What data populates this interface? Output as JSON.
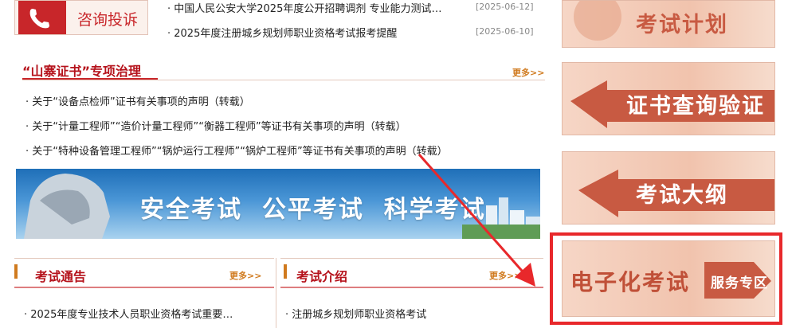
{
  "consult": {
    "label": "咨询投诉",
    "icon": "phone-icon"
  },
  "top_news": [
    {
      "title": "中国人民公安大学2025年度公开招聘调剂 专业能力测试…",
      "date": "[2025-06-12]"
    },
    {
      "title": "2025年度注册城乡规划师职业资格考试报考提醒",
      "date": "[2025-06-10]"
    }
  ],
  "fake_cert": {
    "title": "“山寨证书”专项治理",
    "more": "更多>>",
    "items": [
      "关于“设备点检师”证书有关事项的声明（转载）",
      "关于“计量工程师”“造价计量工程师”“衡器工程师”等证书有关事项的声明（转载）",
      "关于“特种设备管理工程师”“锅炉运行工程师”“锅炉工程师”等证书有关事项的声明（转载）"
    ]
  },
  "banner": {
    "text": "安全考试  公平考试  科学考试"
  },
  "notices": {
    "title": "考试通告",
    "more": "更多>>",
    "items": [
      "2025年度专业技术人员职业资格考试重要…"
    ]
  },
  "intro": {
    "title": "考试介绍",
    "more": "更多>>",
    "items": [
      "注册城乡规划师职业资格考试"
    ]
  },
  "sidebar": {
    "plan": "考试计划",
    "cert_check": "证书查询验证",
    "outline": "考试大纲",
    "electronic": "电子化考试",
    "service": "服务专区"
  },
  "colors": {
    "brand_red": "#b5121b",
    "highlight_red": "#e8282b",
    "more_orange": "#d07a1e"
  }
}
